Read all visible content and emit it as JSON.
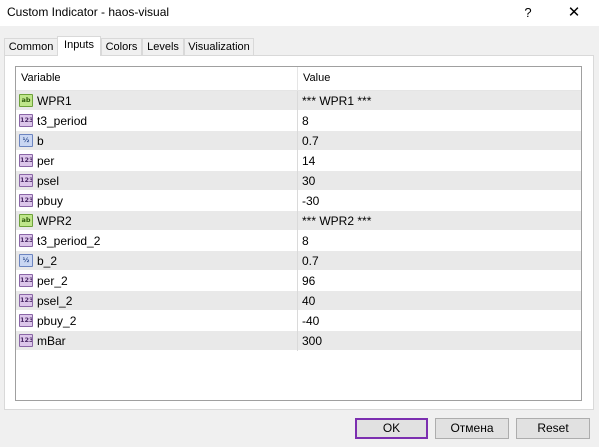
{
  "window": {
    "title": "Custom Indicator - haos-visual",
    "help_glyph": "?",
    "close_glyph": "✕"
  },
  "tabs": [
    {
      "label": "Common",
      "active": false
    },
    {
      "label": "Inputs",
      "active": true
    },
    {
      "label": "Colors",
      "active": false
    },
    {
      "label": "Levels",
      "active": false
    },
    {
      "label": "Visualization",
      "active": false
    }
  ],
  "grid": {
    "columns": {
      "variable": "Variable",
      "value": "Value"
    },
    "rows": [
      {
        "type": "string",
        "icon": "string-type-icon",
        "icon_text": "ab",
        "name": "WPR1",
        "value": "*** WPR1 ***"
      },
      {
        "type": "int",
        "icon": "integer-type-icon",
        "icon_text": "123",
        "name": "t3_period",
        "value": "8"
      },
      {
        "type": "double",
        "icon": "double-type-icon",
        "icon_text": "½",
        "name": "b",
        "value": "0.7"
      },
      {
        "type": "int",
        "icon": "integer-type-icon",
        "icon_text": "123",
        "name": "per",
        "value": "14"
      },
      {
        "type": "int",
        "icon": "integer-type-icon",
        "icon_text": "123",
        "name": "psel",
        "value": "30"
      },
      {
        "type": "int",
        "icon": "integer-type-icon",
        "icon_text": "123",
        "name": "pbuy",
        "value": "-30"
      },
      {
        "type": "string",
        "icon": "string-type-icon",
        "icon_text": "ab",
        "name": "WPR2",
        "value": "*** WPR2 ***"
      },
      {
        "type": "int",
        "icon": "integer-type-icon",
        "icon_text": "123",
        "name": "t3_period_2",
        "value": "8"
      },
      {
        "type": "double",
        "icon": "double-type-icon",
        "icon_text": "½",
        "name": "b_2",
        "value": "0.7"
      },
      {
        "type": "int",
        "icon": "integer-type-icon",
        "icon_text": "123",
        "name": "per_2",
        "value": "96"
      },
      {
        "type": "int",
        "icon": "integer-type-icon",
        "icon_text": "123",
        "name": "psel_2",
        "value": "40"
      },
      {
        "type": "int",
        "icon": "integer-type-icon",
        "icon_text": "123",
        "name": "pbuy_2",
        "value": "-40"
      },
      {
        "type": "int",
        "icon": "integer-type-icon",
        "icon_text": "123",
        "name": "mBar",
        "value": "300"
      }
    ]
  },
  "buttons": {
    "ok": "OK",
    "cancel": "Отмена",
    "reset": "Reset"
  },
  "colors": {
    "ok_border": "#7c2fb0",
    "row_stripe": "#e9e9e9"
  }
}
